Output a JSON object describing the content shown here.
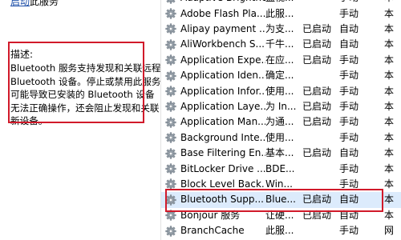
{
  "left_pane": {
    "link_start": "启动",
    "link_suffix": "此服务",
    "description_heading": "描述:",
    "description_text": "Bluetooth 服务支持发现和关联远程 Bluetooth 设备。停止或禁用此服务可能导致已安装的 Bluetooth 设备无法正确操作，还会阻止发现和关联新设备。"
  },
  "services": [
    {
      "name": "Adaptive Brightness",
      "description": "监视...",
      "status": "",
      "startup": "手动",
      "logon": "本"
    },
    {
      "name": "Adobe Flash Pla...",
      "description": "此服...",
      "status": "",
      "startup": "手动",
      "logon": "本"
    },
    {
      "name": "Alipay payment ...",
      "description": "为支...",
      "status": "已启动",
      "startup": "自动",
      "logon": "本"
    },
    {
      "name": "AliWorkbench S...",
      "description": "千牛...",
      "status": "已启动",
      "startup": "自动",
      "logon": "本"
    },
    {
      "name": "Application Expe...",
      "description": "在应...",
      "status": "已启动",
      "startup": "手动",
      "logon": "本"
    },
    {
      "name": "Application Iden...",
      "description": "确定...",
      "status": "",
      "startup": "手动",
      "logon": "本"
    },
    {
      "name": "Application Infor...",
      "description": "使用...",
      "status": "已启动",
      "startup": "手动",
      "logon": "本"
    },
    {
      "name": "Application Laye...",
      "description": "为 In...",
      "status": "已启动",
      "startup": "手动",
      "logon": "本"
    },
    {
      "name": "Application Man...",
      "description": "为通...",
      "status": "已启动",
      "startup": "手动",
      "logon": "本"
    },
    {
      "name": "Background Inte...",
      "description": "使用...",
      "status": "",
      "startup": "手动",
      "logon": "本"
    },
    {
      "name": "Base Filtering En...",
      "description": "基本...",
      "status": "已启动",
      "startup": "自动",
      "logon": "本"
    },
    {
      "name": "BitLocker Drive ...",
      "description": "BDE...",
      "status": "",
      "startup": "手动",
      "logon": "本"
    },
    {
      "name": "Block Level Back...",
      "description": "Win...",
      "status": "",
      "startup": "手动",
      "logon": "本"
    },
    {
      "name": "Bluetooth Supp...",
      "description": "Blue...",
      "status": "已启动",
      "startup": "自动",
      "logon": "本",
      "selected": true
    },
    {
      "name": "Bonjour 服务",
      "description": "让硬...",
      "status": "已启动",
      "startup": "自动",
      "logon": "本"
    },
    {
      "name": "BranchCache",
      "description": "此服...",
      "status": "",
      "startup": "手动",
      "logon": "网"
    }
  ]
}
